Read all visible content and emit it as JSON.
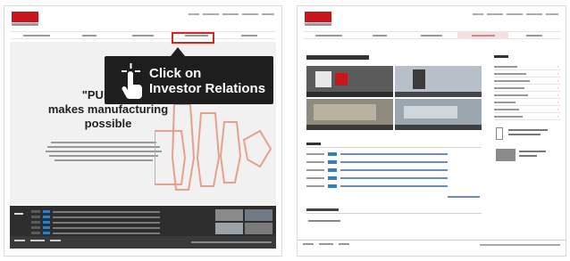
{
  "callout": {
    "line1": "Click on",
    "line2": "Investor Relations"
  },
  "hero": {
    "headline_line1": "\"PUNCH\"",
    "headline_line2": "makes manufacturing",
    "headline_line3": "possible"
  },
  "colors": {
    "brand_red": "#c8161d",
    "highlight_red": "#d9251d",
    "callout_bg": "#1e1e1e",
    "footer_bg": "#3a3a3a",
    "news_bar_bg": "#2e2e2e",
    "link_blue": "#2f7fc1"
  },
  "icons": {
    "cursor": "tap-hand-icon",
    "logo": "company-logo",
    "punch_art": "punch-tool-outline-art",
    "side_arrow": "chevron-right-icon"
  },
  "left_screen": {
    "nav_highlighted": "investor-relations"
  },
  "right_screen": {
    "nav_highlighted": "investor-relations",
    "side_menu_item_count": 10
  }
}
